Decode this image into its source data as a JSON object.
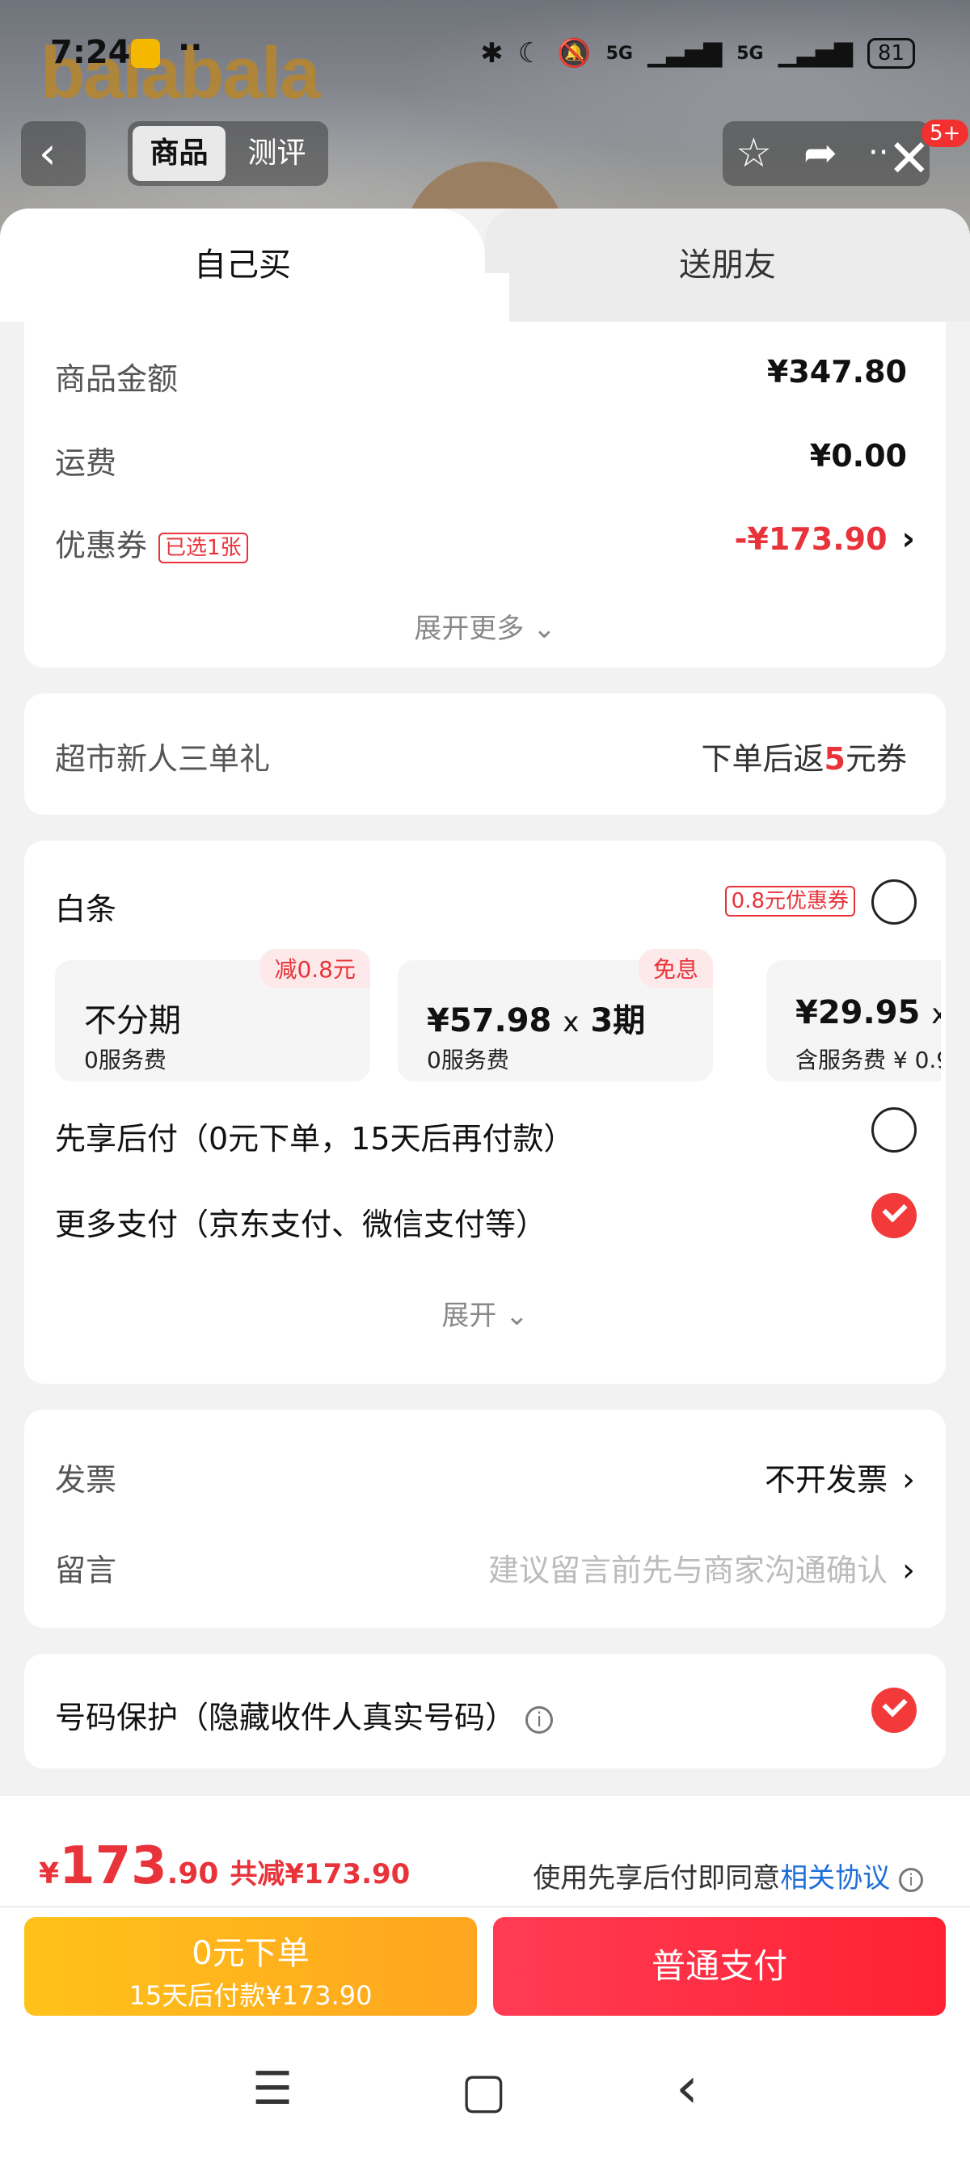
{
  "status_bar": {
    "time": "7:24",
    "dots": "··",
    "signal_1": "5G",
    "signal_2": "5G",
    "battery": "81"
  },
  "background_page": {
    "brand_logo": "balabala",
    "tabs": [
      {
        "label": "商品",
        "active": true
      },
      {
        "label": "测评",
        "active": false
      }
    ],
    "badge": "5+"
  },
  "sheet": {
    "tabs": [
      {
        "label": "自己买",
        "active": true
      },
      {
        "label": "送朋友",
        "active": false
      }
    ],
    "summary": {
      "goods_amount_label": "商品金额",
      "goods_amount": "¥347.80",
      "shipping_label": "运费",
      "shipping": "¥0.00",
      "coupon_label": "优惠券",
      "coupon_tag": "已选1张",
      "coupon_value": "-¥173.90",
      "expand_more": "展开更多"
    },
    "new_user": {
      "label": "超市新人三单礼",
      "reward_prefix": "下单后返",
      "reward_amount": "5",
      "reward_suffix": "元券"
    },
    "baitiao": {
      "label": "白条",
      "coupon_tag": "0.8元优惠券",
      "selected": false,
      "plans": [
        {
          "corner": "减0.8元",
          "main": "不分期",
          "mult": "",
          "period": "",
          "sub": "0服务费"
        },
        {
          "corner": "免息",
          "main": "¥57.98",
          "mult": "x",
          "period": "3期",
          "sub": "0服务费"
        },
        {
          "corner": "",
          "main": "¥29.95",
          "mult": "x",
          "period": "",
          "sub": "含服务费 ¥ 0.9"
        }
      ],
      "bnpl_label": "先享后付（0元下单，15天后再付款）",
      "bnpl_selected": false,
      "more_label": "更多支付（京东支付、微信支付等）",
      "more_selected": true,
      "expand": "展开"
    },
    "invoice": {
      "label": "发票",
      "value": "不开发票",
      "note_label": "留言",
      "note_placeholder": "建议留言前先与商家沟通确认"
    },
    "privacy": {
      "label": "号码保护（隐藏收件人真实号码）",
      "checked": true
    }
  },
  "bottom_bar": {
    "currency": "¥",
    "total_int": "173",
    "total_dec": ".90",
    "saved": "共减¥173.90",
    "agree_prefix": "使用先享后付即同意",
    "agree_link": "相关协议",
    "bnpl_button_line1": "0元下单",
    "bnpl_button_line2": "15天后付款¥173.90",
    "pay_button": "普通支付"
  },
  "colors": {
    "accent_red": "#e8333a",
    "bnpl_yellow": "#ffb21d",
    "link_blue": "#1e6fd8"
  }
}
